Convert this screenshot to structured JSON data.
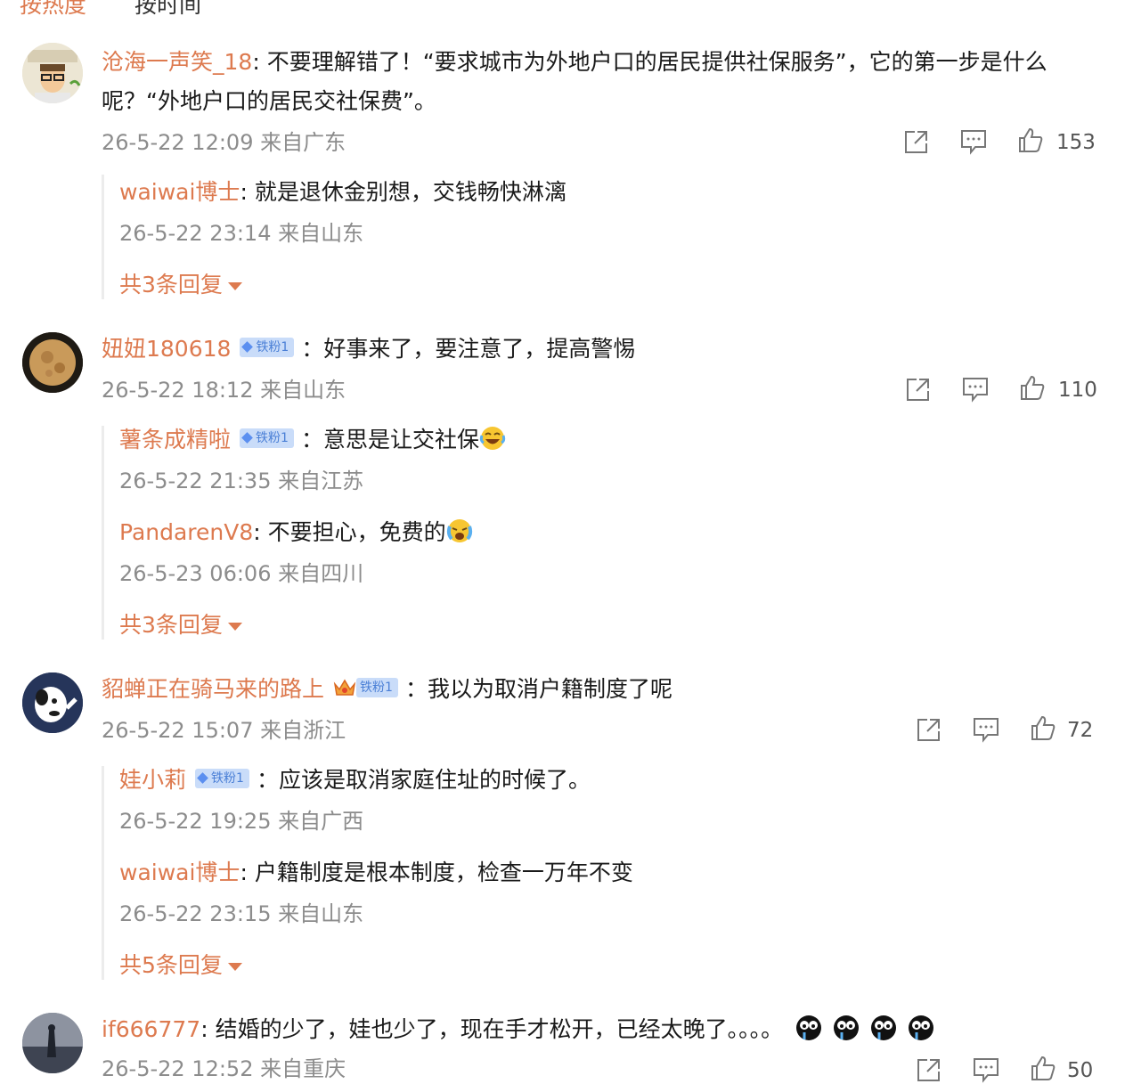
{
  "sort": {
    "hot": "按热度",
    "time": "按时间"
  },
  "sub_separator": "：",
  "comments": [
    {
      "user": "沧海一声笑_18",
      "text_line1": "不要理解错了！“要求城市为外地户口的居民提供社保服务”，它的第一步是什么",
      "text_line2": "呢？“外地户口的居民交社保费”。",
      "meta": "26-5-22 12:09 来自广东",
      "likes": "153",
      "replies": [
        {
          "user": "waiwai博士",
          "text": "就是退休金别想，交钱畅快淋漓",
          "meta": "26-5-22 23:14 来自山东"
        }
      ],
      "more": "共3条回复"
    },
    {
      "user": "妞妞180618",
      "badge": "铁粉1",
      "text": "好事来了，要注意了，提高警惕",
      "meta": "26-5-22 18:12 来自山东",
      "likes": "110",
      "replies": [
        {
          "user": "薯条成精啦",
          "badge": "铁粉1",
          "text": "意思是让交社保",
          "meta": "26-5-22 21:35 来自江苏",
          "emoji": "laugh-cry-emoji"
        },
        {
          "user": "PandarenV8",
          "text": "不要担心，免费的",
          "meta": "26-5-23 06:06 来自四川",
          "emoji": "crying-emoji"
        }
      ],
      "more": "共3条回复"
    },
    {
      "user": "貂蝉正在骑马来的路上",
      "badge": "铁粉1",
      "text": "我以为取消户籍制度了呢",
      "meta": "26-5-22 15:07 来自浙江",
      "likes": "72",
      "replies": [
        {
          "user": "娃小莉",
          "badge": "铁粉1",
          "text": "应该是取消家庭住址的时候了。",
          "meta": "26-5-22 19:25 来自广西"
        },
        {
          "user": "waiwai博士",
          "text": "户籍制度是根本制度，检查一万年不变",
          "meta": "26-5-22 23:15 来自山东"
        }
      ],
      "more": "共5条回复"
    },
    {
      "user": "if666777",
      "text": "结婚的少了，娃也少了，现在手才松开，已经太晚了。。。。",
      "meta": "26-5-22 12:52 来自重庆",
      "likes": "50"
    }
  ],
  "colors": {
    "name": "#dd7a4f",
    "meta": "#8c8c8c",
    "badge_bg": "#c9dcf9",
    "badge_text": "#4a7fd6"
  }
}
